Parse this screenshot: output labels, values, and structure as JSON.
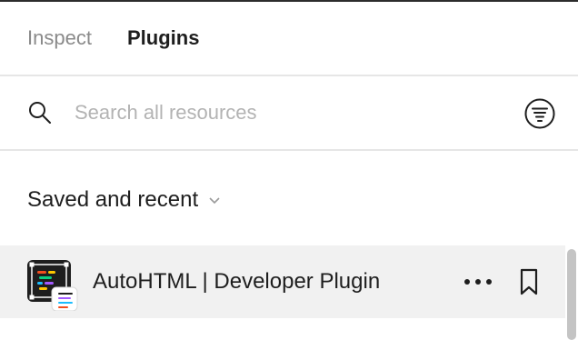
{
  "tabs": [
    {
      "label": "Inspect",
      "active": false
    },
    {
      "label": "Plugins",
      "active": true
    }
  ],
  "search": {
    "placeholder": "Search all resources",
    "value": "",
    "search_icon": "search-icon",
    "filter_icon": "filter-icon"
  },
  "section": {
    "title": "Saved and recent",
    "chevron_icon": "chevron-down-icon"
  },
  "plugins": [
    {
      "name": "AutoHTML | Developer Plugin",
      "icon": "autohtml-plugin-icon",
      "more_icon": "more-icon",
      "bookmark_icon": "bookmark-icon"
    }
  ],
  "colors": {
    "text_primary": "#1e1e1e",
    "text_muted": "#8a8a8a",
    "placeholder": "#b3b3b3",
    "divider": "#e6e6e6",
    "row_highlight": "#f1f1f1"
  }
}
